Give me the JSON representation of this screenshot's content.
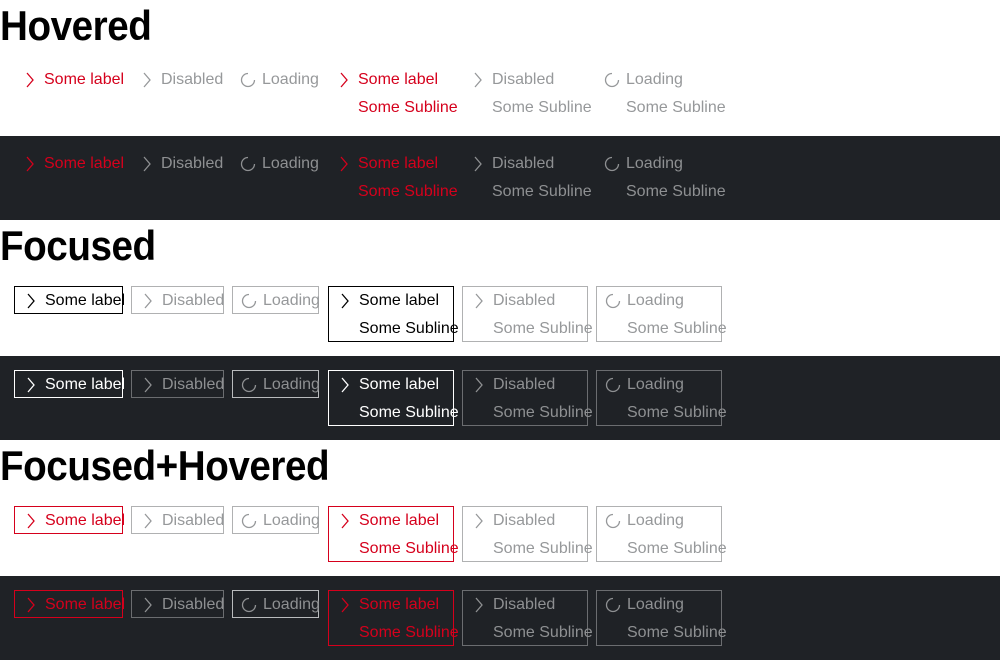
{
  "sections": [
    {
      "title": "Hovered"
    },
    {
      "title": "Focused"
    },
    {
      "title": "Focused+Hovered"
    }
  ],
  "labels": {
    "primary": "Some label",
    "disabled": "Disabled",
    "loading": "Loading",
    "subline": "Some Subline"
  },
  "colors": {
    "accent_red": "#d5001c",
    "dark_background": "#1f2226",
    "disabled_grey": "#96989a"
  },
  "icons": {
    "arrow": "arrow-right-icon",
    "spinner": "spinner-icon"
  }
}
